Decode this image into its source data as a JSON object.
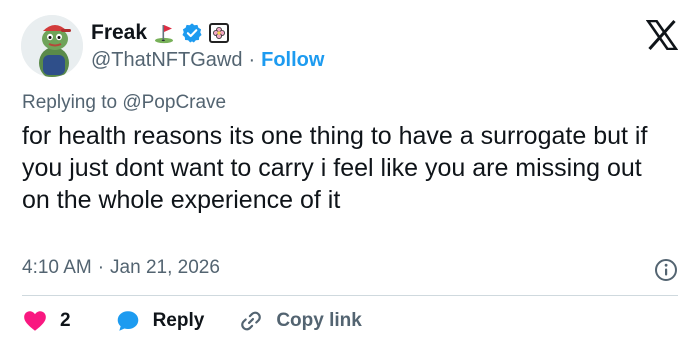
{
  "author": {
    "display_name": "Freak",
    "handle": "@ThatNFTGawd",
    "follow_label": "Follow",
    "separator": "·",
    "icons": [
      "avatar-frog",
      "golf-flag-emoji",
      "verified-badge-icon",
      "flower-badge-icon"
    ],
    "verified_color": "#1d9bf0"
  },
  "reply": {
    "prefix": "Replying to",
    "mention": "@PopCrave"
  },
  "tweet": {
    "text": "for health reasons its one thing to have a surrogate but if you just dont want to carry i feel like you are missing out on the whole experience of it",
    "time": "4:10 AM",
    "separator": "·",
    "date": "Jan 21, 2026"
  },
  "actions": {
    "like_count": "2",
    "reply_label": "Reply",
    "copy_label": "Copy link"
  },
  "colors": {
    "accent": "#1d9bf0",
    "like": "#f91880",
    "text": "#0f1419",
    "muted": "#536471"
  }
}
